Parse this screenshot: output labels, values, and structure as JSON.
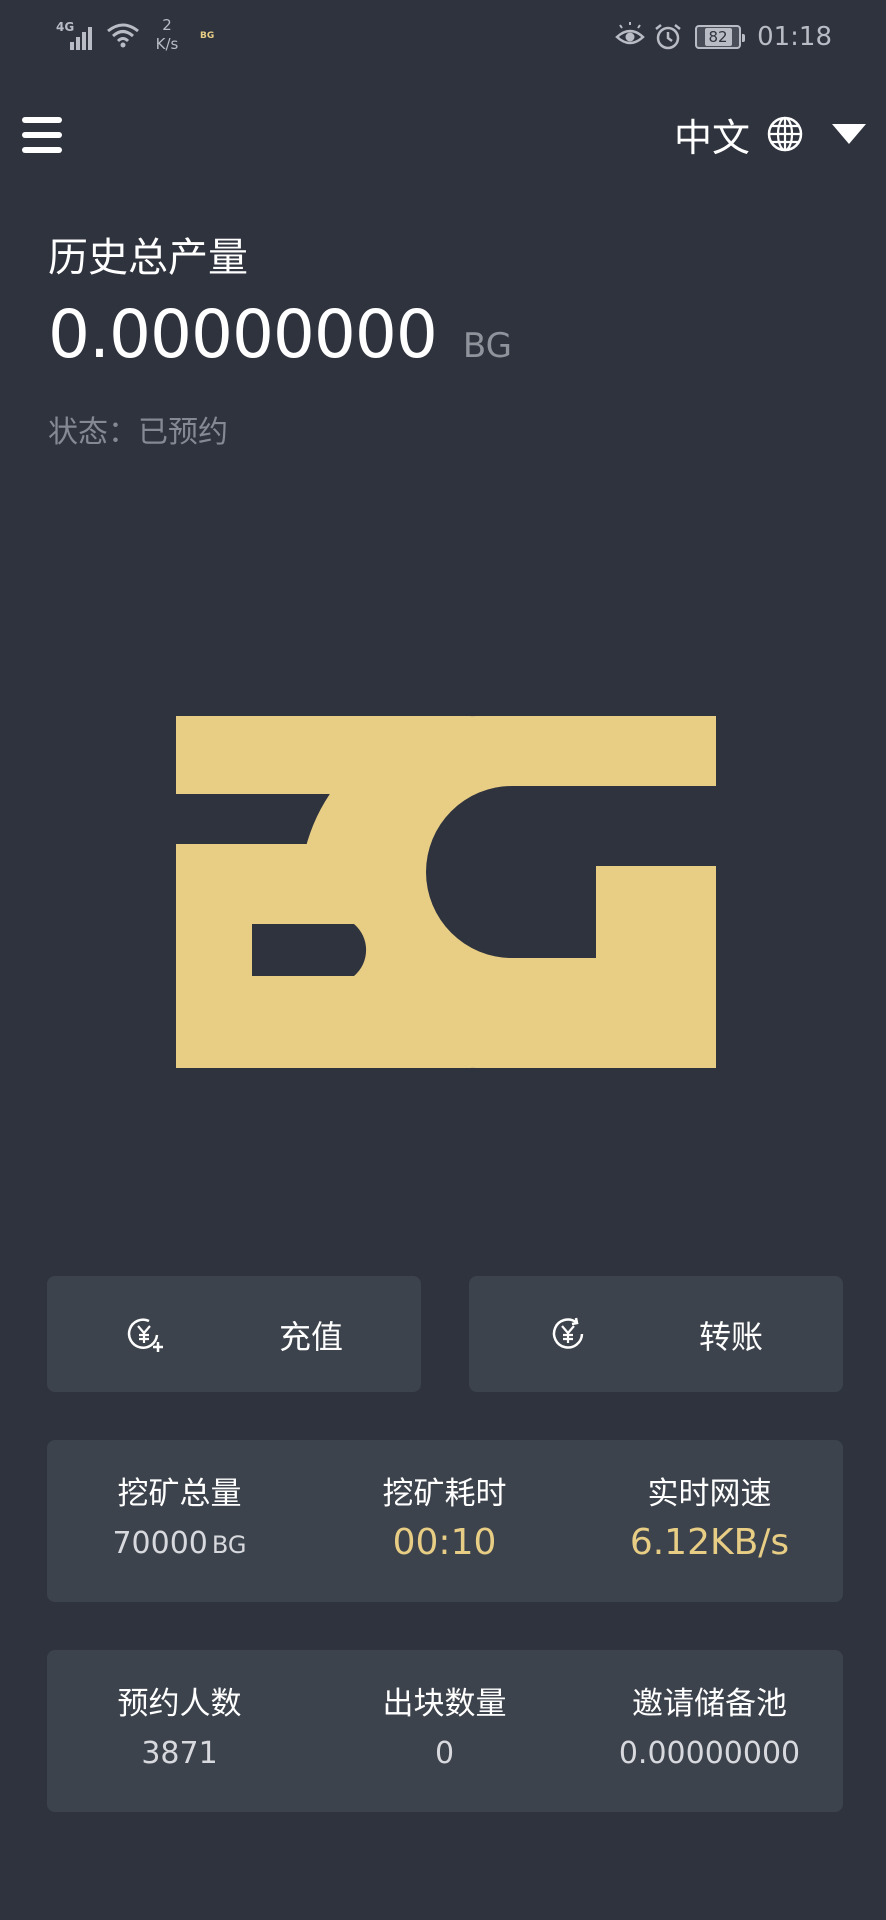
{
  "status_bar": {
    "network": "4G",
    "speed_value": "2",
    "speed_unit": "K/s",
    "app_icon_text": "BG",
    "battery": "82",
    "time": "01:18"
  },
  "header": {
    "language": "中文"
  },
  "summary": {
    "title": "历史总产量",
    "value": "0.00000000",
    "unit": "BG",
    "status": "状态：已预约"
  },
  "logo": {
    "text": "BG",
    "color": "#e8cd85"
  },
  "actions": {
    "recharge_label": "充值",
    "transfer_label": "转账"
  },
  "stats_row1": {
    "total_mining_label": "挖矿总量",
    "total_mining_value": "70000",
    "total_mining_unit": "BG",
    "mining_time_label": "挖矿耗时",
    "mining_time_value": "00:10",
    "net_speed_label": "实时网速",
    "net_speed_value": "6.12KB/s"
  },
  "stats_row2": {
    "reservations_label": "预约人数",
    "reservations_value": "3871",
    "blocks_label": "出块数量",
    "blocks_value": "0",
    "invite_pool_label": "邀请储备池",
    "invite_pool_value": "0.00000000"
  },
  "colors": {
    "background": "#2f333e",
    "card": "#3d434c",
    "accent": "#e8cd85"
  }
}
